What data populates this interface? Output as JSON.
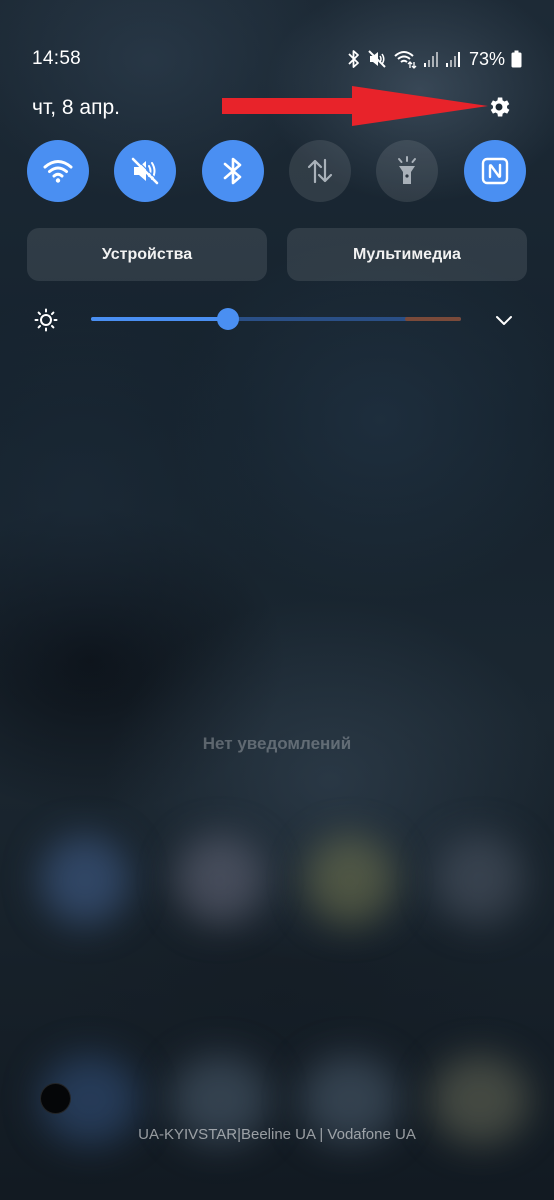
{
  "status_bar": {
    "time": "14:58",
    "battery_percent": "73%",
    "icons": [
      "bluetooth-icon",
      "mute-icon",
      "wifi-calling-icon",
      "signal-icon",
      "signal-icon",
      "battery-icon"
    ]
  },
  "header": {
    "date": "чт, 8 апр.",
    "settings_icon": "gear-icon",
    "annotation": "red-arrow-pointing-to-settings"
  },
  "quick_tiles": [
    {
      "name": "wifi",
      "icon": "wifi-icon",
      "state": "on"
    },
    {
      "name": "sound",
      "icon": "mute-icon",
      "state": "on"
    },
    {
      "name": "bluetooth",
      "icon": "bluetooth-icon",
      "state": "on"
    },
    {
      "name": "mobile-data",
      "icon": "data-arrows-icon",
      "state": "off"
    },
    {
      "name": "flashlight",
      "icon": "flashlight-icon",
      "state": "off"
    },
    {
      "name": "nfc",
      "icon": "nfc-icon",
      "state": "on"
    }
  ],
  "panels": {
    "devices_label": "Устройства",
    "media_label": "Мультимедиа"
  },
  "brightness": {
    "level": 0.37,
    "icon": "sun-icon",
    "expand_icon": "chevron-down-icon"
  },
  "notifications": {
    "empty_text": "Нет уведомлений"
  },
  "footer": {
    "carrier_text": "UA-KYIVSTAR|Beeline UA | Vodafone UA"
  },
  "colors": {
    "accent": "#4a8ff2",
    "tile_off": "#2b3540",
    "arrow": "#e8232a"
  }
}
